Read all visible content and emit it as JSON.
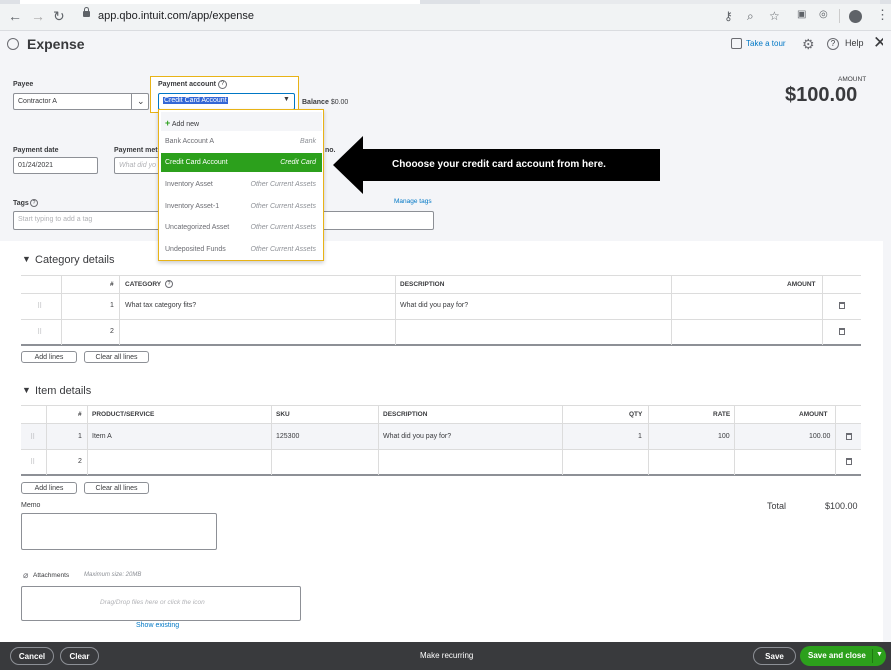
{
  "browser": {
    "url": "app.qbo.intuit.com/app/expense"
  },
  "header": {
    "title": "Expense",
    "take_tour": "Take a tour",
    "help": "Help"
  },
  "form": {
    "payee_label": "Payee",
    "payee_value": "Contractor A",
    "payment_account_label": "Payment account",
    "payment_account_value": "Credit Card Account",
    "balance_label": "Balance",
    "balance_value": "$0.00",
    "amount_label": "AMOUNT",
    "amount_value": "$100.00",
    "payment_date_label": "Payment date",
    "payment_date_value": "01/24/2021",
    "payment_method_label": "Payment meth",
    "payment_method_placeholder": "What did yo",
    "ref_label": "no.",
    "tags_label": "Tags",
    "tags_placeholder": "Start typing to add a tag",
    "manage_tags": "Manage tags"
  },
  "dropdown": {
    "add_new": "Add new",
    "items": [
      {
        "name": "Bank Account A",
        "type": "Bank"
      },
      {
        "name": "Credit Card Account",
        "type": "Credit Card"
      },
      {
        "name": "Inventory Asset",
        "type": "Other Current Assets"
      },
      {
        "name": "Inventory Asset-1",
        "type": "Other Current Assets"
      },
      {
        "name": "Uncategorized Asset",
        "type": "Other Current Assets"
      },
      {
        "name": "Undeposited Funds",
        "type": "Other Current Assets"
      }
    ]
  },
  "callout": {
    "text": "Chooose your credit card account from here."
  },
  "category_details": {
    "title": "Category details",
    "headers": {
      "num": "#",
      "category": "CATEGORY",
      "description": "DESCRIPTION",
      "amount": "AMOUNT"
    },
    "rows": [
      {
        "num": "1",
        "category_placeholder": "What tax category fits?",
        "description_placeholder": "What did you pay for?"
      },
      {
        "num": "2"
      }
    ],
    "add_lines": "Add lines",
    "clear_all_lines": "Clear all lines"
  },
  "item_details": {
    "title": "Item details",
    "headers": {
      "num": "#",
      "product": "PRODUCT/SERVICE",
      "sku": "SKU",
      "description": "DESCRIPTION",
      "qty": "QTY",
      "rate": "RATE",
      "amount": "AMOUNT"
    },
    "rows": [
      {
        "num": "1",
        "product": "Item A",
        "sku": "125300",
        "description_placeholder": "What did you pay for?",
        "qty": "1",
        "rate": "100",
        "amount": "100.00"
      },
      {
        "num": "2"
      }
    ],
    "add_lines": "Add lines",
    "clear_all_lines": "Clear all lines"
  },
  "totals": {
    "label": "Total",
    "value": "$100.00"
  },
  "memo": {
    "label": "Memo"
  },
  "attachments": {
    "label": "Attachments",
    "max_size": "Maximum size: 20MB",
    "drop_text": "Drag/Drop files here or click the icon",
    "show_existing": "Show existing"
  },
  "footer": {
    "cancel": "Cancel",
    "clear": "Clear",
    "make_recurring": "Make recurring",
    "save": "Save",
    "save_and_close": "Save and close"
  },
  "colors": {
    "accent_green": "#2ca01c",
    "link_blue": "#0077c5",
    "highlight_yellow": "#e8b317"
  }
}
